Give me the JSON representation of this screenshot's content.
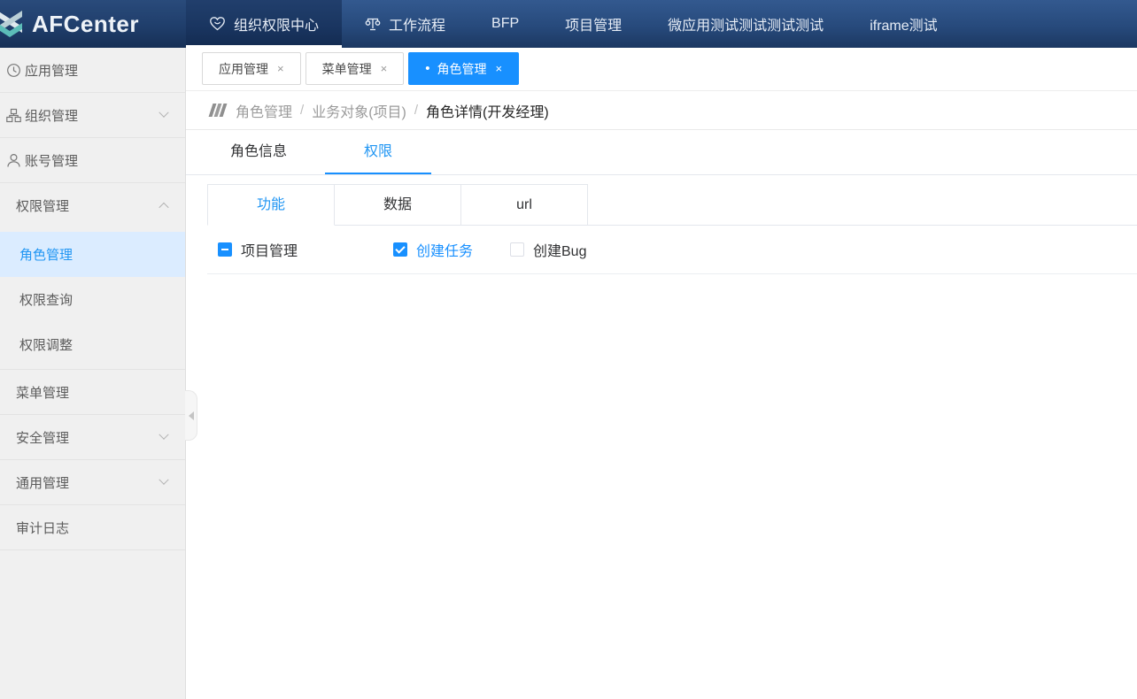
{
  "navbar": {
    "brand": "AFCenter",
    "items": [
      {
        "label": "组织权限中心",
        "icon": "heart-face-icon",
        "active": true
      },
      {
        "label": "工作流程",
        "icon": "workflow-icon",
        "active": false
      },
      {
        "label": "BFP",
        "active": false
      },
      {
        "label": "项目管理",
        "active": false
      },
      {
        "label": "微应用测试测试测试测试",
        "active": false
      },
      {
        "label": "iframe测试",
        "active": false
      }
    ]
  },
  "sidebar": {
    "items": [
      {
        "label": "应用管理",
        "icon": "clock-icon"
      },
      {
        "label": "组织管理",
        "icon": "org-icon",
        "chevron": "down"
      },
      {
        "label": "账号管理",
        "icon": "user-icon"
      },
      {
        "label": "权限管理",
        "chevron": "up",
        "expanded": true
      },
      {
        "label": "角色管理",
        "sub": true,
        "active": true
      },
      {
        "label": "权限查询",
        "sub": true
      },
      {
        "label": "权限调整",
        "sub": true
      },
      {
        "label": "菜单管理"
      },
      {
        "label": "安全管理",
        "chevron": "down"
      },
      {
        "label": "通用管理",
        "chevron": "down"
      },
      {
        "label": "审计日志"
      }
    ]
  },
  "tabbar": {
    "close_label": "×",
    "active_dot": "•",
    "tabs": [
      {
        "label": "应用管理",
        "active": false
      },
      {
        "label": "菜单管理",
        "active": false
      },
      {
        "label": "角色管理",
        "active": true
      }
    ]
  },
  "breadcrumb": {
    "separator": "/",
    "items": [
      {
        "label": "角色管理",
        "current": false
      },
      {
        "label": "业务对象(项目)",
        "current": false
      },
      {
        "label": "角色详情(开发经理)",
        "current": true
      }
    ]
  },
  "role_tabs": [
    {
      "label": "角色信息",
      "active": false
    },
    {
      "label": "权限",
      "active": true
    }
  ],
  "perm_tabs": [
    {
      "label": "功能",
      "active": true
    },
    {
      "label": "数据",
      "active": false
    },
    {
      "label": "url",
      "active": false
    }
  ],
  "permissions": [
    {
      "label": "项目管理",
      "state": "indeterminate"
    },
    {
      "label": "创建任务",
      "state": "checked"
    },
    {
      "label": "创建Bug",
      "state": "unchecked"
    }
  ],
  "colors": {
    "accent": "#1890ff",
    "accent_text": "#2196f3",
    "navbar_top": "#33598f",
    "navbar_bottom": "#1c3862",
    "sidebar_bg": "#f0f0f0",
    "sidebar_active_bg": "#dbecff",
    "logo_teal": "#5cbdb8"
  }
}
